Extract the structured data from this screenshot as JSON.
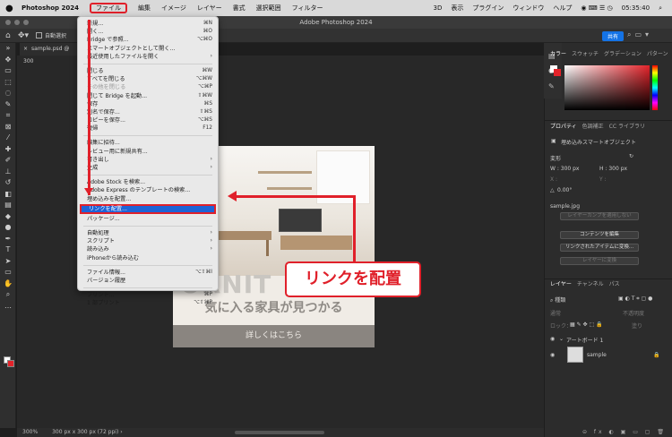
{
  "menubar": {
    "apple": "",
    "app_name": "Photoshop 2024",
    "items": [
      "ファイル",
      "編集",
      "イメージ",
      "レイヤー",
      "書式",
      "選択範囲",
      "フィルター",
      "3D",
      "表示",
      "プラグイン",
      "ウィンドウ",
      "ヘルプ"
    ],
    "clock": "05:35:40"
  },
  "window": {
    "title": "Adobe Photoshop 2024"
  },
  "options_bar": {
    "autoselect_label": "自動選択",
    "share_label": "共有"
  },
  "document_tab": {
    "name": "sample.psd @ 300"
  },
  "file_menu": {
    "items": [
      {
        "label": "新規...",
        "shortcut": "⌘N",
        "disabled": false
      },
      {
        "label": "開く...",
        "shortcut": "⌘O",
        "disabled": false
      },
      {
        "label": "Bridge で参照...",
        "shortcut": "⌥⌘O",
        "disabled": false
      },
      {
        "label": "スマートオブジェクトとして開く...",
        "shortcut": "",
        "disabled": false
      },
      {
        "label": "最近使用したファイルを開く",
        "shortcut": "›",
        "disabled": false
      },
      {
        "sep": true
      },
      {
        "label": "閉じる",
        "shortcut": "⌘W",
        "disabled": false
      },
      {
        "label": "すべてを閉じる",
        "shortcut": "⌥⌘W",
        "disabled": false
      },
      {
        "label": "その他を閉じる",
        "shortcut": "⌥⌘P",
        "disabled": true
      },
      {
        "label": "閉じて Bridge を起動...",
        "shortcut": "⇧⌘W",
        "disabled": false
      },
      {
        "label": "保存",
        "shortcut": "⌘S",
        "disabled": false
      },
      {
        "label": "別名で保存...",
        "shortcut": "⇧⌘S",
        "disabled": false
      },
      {
        "label": "コピーを保存...",
        "shortcut": "⌥⌘S",
        "disabled": false
      },
      {
        "label": "復帰",
        "shortcut": "F12",
        "disabled": false
      },
      {
        "sep": true
      },
      {
        "label": "編集に招待...",
        "shortcut": "",
        "disabled": false
      },
      {
        "label": "レビュー用に新規共有...",
        "shortcut": "",
        "disabled": false
      },
      {
        "label": "書き出し",
        "shortcut": "›",
        "disabled": false
      },
      {
        "label": "生成",
        "shortcut": "›",
        "disabled": false
      },
      {
        "sep": true
      },
      {
        "label": "Adobe Stock を検索...",
        "shortcut": "",
        "disabled": false
      },
      {
        "label": "Adobe Express のテンプレートの検索...",
        "shortcut": "",
        "disabled": false
      },
      {
        "label": "埋め込みを配置...",
        "shortcut": "",
        "disabled": false
      },
      {
        "label": "リンクを配置...",
        "shortcut": "",
        "disabled": false,
        "highlighted": true
      },
      {
        "label": "パッケージ...",
        "shortcut": "",
        "disabled": false
      },
      {
        "sep": true
      },
      {
        "label": "自動処理",
        "shortcut": "›",
        "disabled": false
      },
      {
        "label": "スクリプト",
        "shortcut": "›",
        "disabled": false
      },
      {
        "label": "読み込み",
        "shortcut": "›",
        "disabled": false
      },
      {
        "label": "iPhoneから読み込む",
        "shortcut": "",
        "disabled": false
      },
      {
        "sep": true
      },
      {
        "label": "ファイル情報...",
        "shortcut": "⌥⇧⌘I",
        "disabled": false
      },
      {
        "label": "バージョン履歴",
        "shortcut": "",
        "disabled": false
      },
      {
        "sep": true
      },
      {
        "label": "プリント...",
        "shortcut": "⌘P",
        "disabled": false
      },
      {
        "label": "1 部プリント",
        "shortcut": "⌥⇧⌘P",
        "disabled": false
      }
    ]
  },
  "callout": {
    "text": "リンクを配置"
  },
  "artboard": {
    "big_text": "URNIT",
    "sub_text": "気に入る家具が見つかる",
    "cta": "詳しくはこちら"
  },
  "color_panel": {
    "tabs": [
      "カラー",
      "スウォッチ",
      "グラデーション",
      "パターン"
    ]
  },
  "properties_panel": {
    "tabs": [
      "プロパティ",
      "色調補正",
      "CC ライブラリ"
    ],
    "object_type": "埋め込みスマートオブジェクト",
    "transform_label": "変形",
    "w": "W : 300 px",
    "h": "H : 300 px",
    "x": "X :",
    "y": "Y :",
    "angle": "0.00°",
    "filename": "sample.jpg",
    "layer_comp": "レイヤーカンプを適用しない",
    "btn_edit": "コンテンツを編集",
    "btn_linked": "リンクされたアイテムに変換...",
    "btn_convert": "レイヤーに変換"
  },
  "layers_panel": {
    "tabs": [
      "レイヤー",
      "チャンネル",
      "パス"
    ],
    "kind": "種類",
    "mode": "通常",
    "opacity": "不透明度",
    "lock": "ロック：",
    "fill": "塗り",
    "artboard_name": "アートボード 1",
    "layer_name": "sample"
  },
  "status_bar": {
    "zoom": "300%",
    "info": "300 px x 300 px (72 ppi)"
  },
  "colors": {
    "accent_red": "#e0202a",
    "highlight_blue": "#1e63d6",
    "share_blue": "#1473e6"
  }
}
